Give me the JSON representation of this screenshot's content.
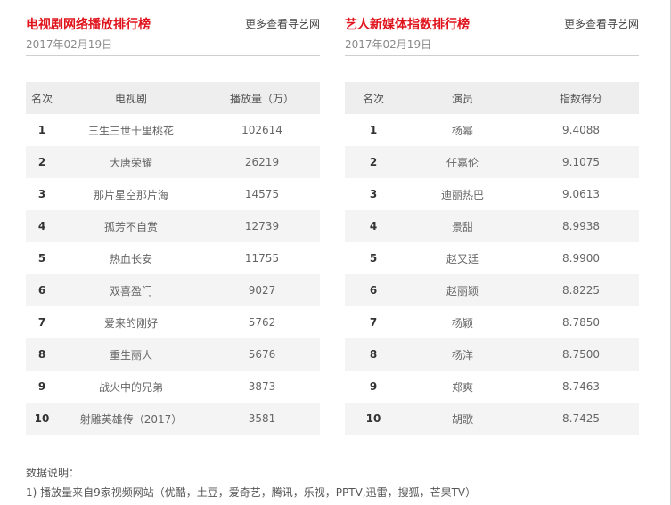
{
  "left_panel": {
    "title": "电视剧网络播放排行榜",
    "more_link": "更多查看寻艺网",
    "date": "2017年02月19日",
    "columns": [
      "名次",
      "电视剧",
      "播放量（万）"
    ],
    "rows": [
      {
        "rank": "1",
        "name": "三生三世十里桃花",
        "value": "102614"
      },
      {
        "rank": "2",
        "name": "大唐荣耀",
        "value": "26219"
      },
      {
        "rank": "3",
        "name": "那片星空那片海",
        "value": "14575"
      },
      {
        "rank": "4",
        "name": "孤芳不自赏",
        "value": "12739"
      },
      {
        "rank": "5",
        "name": "热血长安",
        "value": "11755"
      },
      {
        "rank": "6",
        "name": "双喜盈门",
        "value": "9027"
      },
      {
        "rank": "7",
        "name": "爱来的刚好",
        "value": "5762"
      },
      {
        "rank": "8",
        "name": "重生丽人",
        "value": "5676"
      },
      {
        "rank": "9",
        "name": "战火中的兄弟",
        "value": "3873"
      },
      {
        "rank": "10",
        "name": "射雕英雄传（2017）",
        "value": "3581"
      }
    ]
  },
  "right_panel": {
    "title": "艺人新媒体指数排行榜",
    "more_link": "更多查看寻艺网",
    "date": "2017年02月19日",
    "columns": [
      "名次",
      "演员",
      "指数得分"
    ],
    "rows": [
      {
        "rank": "1",
        "name": "杨幂",
        "value": "9.4088"
      },
      {
        "rank": "2",
        "name": "任嘉伦",
        "value": "9.1075"
      },
      {
        "rank": "3",
        "name": "迪丽热巴",
        "value": "9.0613"
      },
      {
        "rank": "4",
        "name": "景甜",
        "value": "8.9938"
      },
      {
        "rank": "5",
        "name": "赵又廷",
        "value": "8.9900"
      },
      {
        "rank": "6",
        "name": "赵丽颖",
        "value": "8.8225"
      },
      {
        "rank": "7",
        "name": "杨颖",
        "value": "8.7850"
      },
      {
        "rank": "8",
        "name": "杨洋",
        "value": "8.7500"
      },
      {
        "rank": "9",
        "name": "郑爽",
        "value": "8.7463"
      },
      {
        "rank": "10",
        "name": "胡歌",
        "value": "8.7425"
      }
    ]
  },
  "notes": {
    "heading": "数据说明：",
    "line1": "1) 播放量来自9家视频网站（优酷，土豆，爱奇艺，腾讯，乐视，PPTV,迅雷，搜狐，芒果TV）"
  },
  "colors": {
    "title_red": "#e0141d",
    "header_bg": "#eeeeee",
    "stripe_bg": "#f4f4f4"
  }
}
